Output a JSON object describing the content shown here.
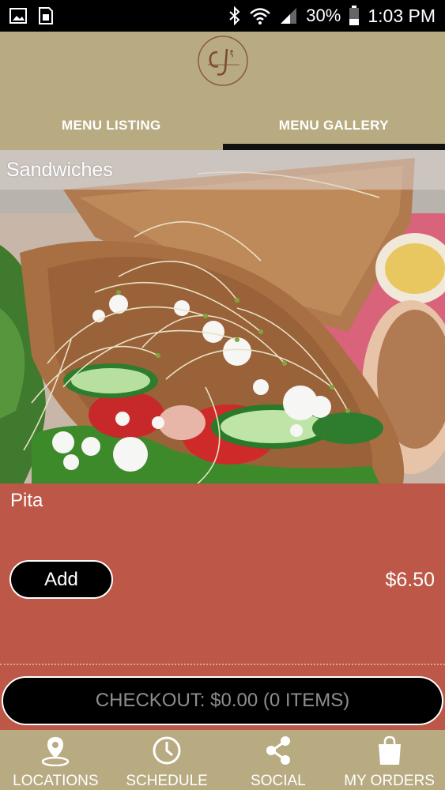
{
  "status_bar": {
    "battery": "30%",
    "time": "1:03 PM",
    "icons": [
      "gallery-icon",
      "sim-icon",
      "bluetooth-icon",
      "wifi-icon",
      "signal-icon",
      "battery-icon"
    ]
  },
  "header": {
    "tabs": [
      {
        "label": "MENU LISTING",
        "active": false
      },
      {
        "label": "MENU GALLERY",
        "active": true
      }
    ]
  },
  "gallery": {
    "category": "Sandwiches"
  },
  "item": {
    "name": "Pita",
    "add_label": "Add",
    "price": "$6.50"
  },
  "checkout": {
    "label": "CHECKOUT: $0.00 (0 ITEMS)"
  },
  "bottom_nav": {
    "items": [
      {
        "label": "LOCATIONS",
        "icon": "location-pin-icon"
      },
      {
        "label": "SCHEDULE",
        "icon": "clock-icon"
      },
      {
        "label": "SOCIAL",
        "icon": "share-icon"
      },
      {
        "label": "MY ORDERS",
        "icon": "shopping-bag-icon"
      }
    ]
  },
  "colors": {
    "header_bg": "#b8ab82",
    "item_panel_bg": "#bd5747",
    "button_bg": "#000000",
    "active_tab_indicator": "#111111"
  }
}
